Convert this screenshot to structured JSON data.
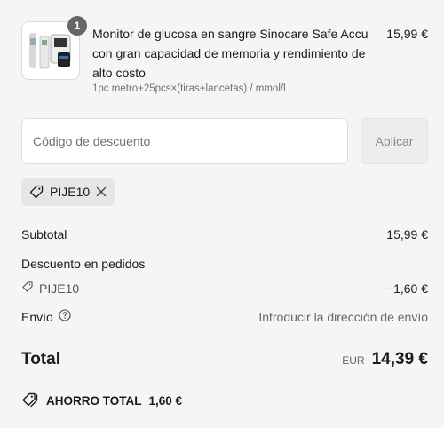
{
  "item": {
    "quantity": "1",
    "title": "Monitor de glucosa en sangre Sinocare Safe Accu con gran capacidad de memoria y rendimiento de alto costo",
    "variant": "1pc metro+25pcs×(tiras+lancetas) / mmol/l",
    "price": "15,99 €"
  },
  "discount": {
    "placeholder": "Código de descuento",
    "apply_label": "Aplicar",
    "applied_code": "PIJE10"
  },
  "summary": {
    "subtotal_label": "Subtotal",
    "subtotal_value": "15,99 €",
    "order_discount_label": "Descuento en pedidos",
    "discount_code": "PIJE10",
    "discount_value": "− 1,60 €",
    "shipping_label": "Envío",
    "shipping_value": "Introducir la dirección de envío",
    "total_label": "Total",
    "currency": "EUR",
    "total_value": "14,39 €",
    "savings_label": "AHORRO TOTAL",
    "savings_value": "1,60 €"
  },
  "colors": {
    "background": "#f5f5f5",
    "badge": "#666666",
    "muted_text": "#666666"
  },
  "icons": [
    "tag-icon",
    "close-icon",
    "info-icon",
    "savings-tags-icon"
  ]
}
